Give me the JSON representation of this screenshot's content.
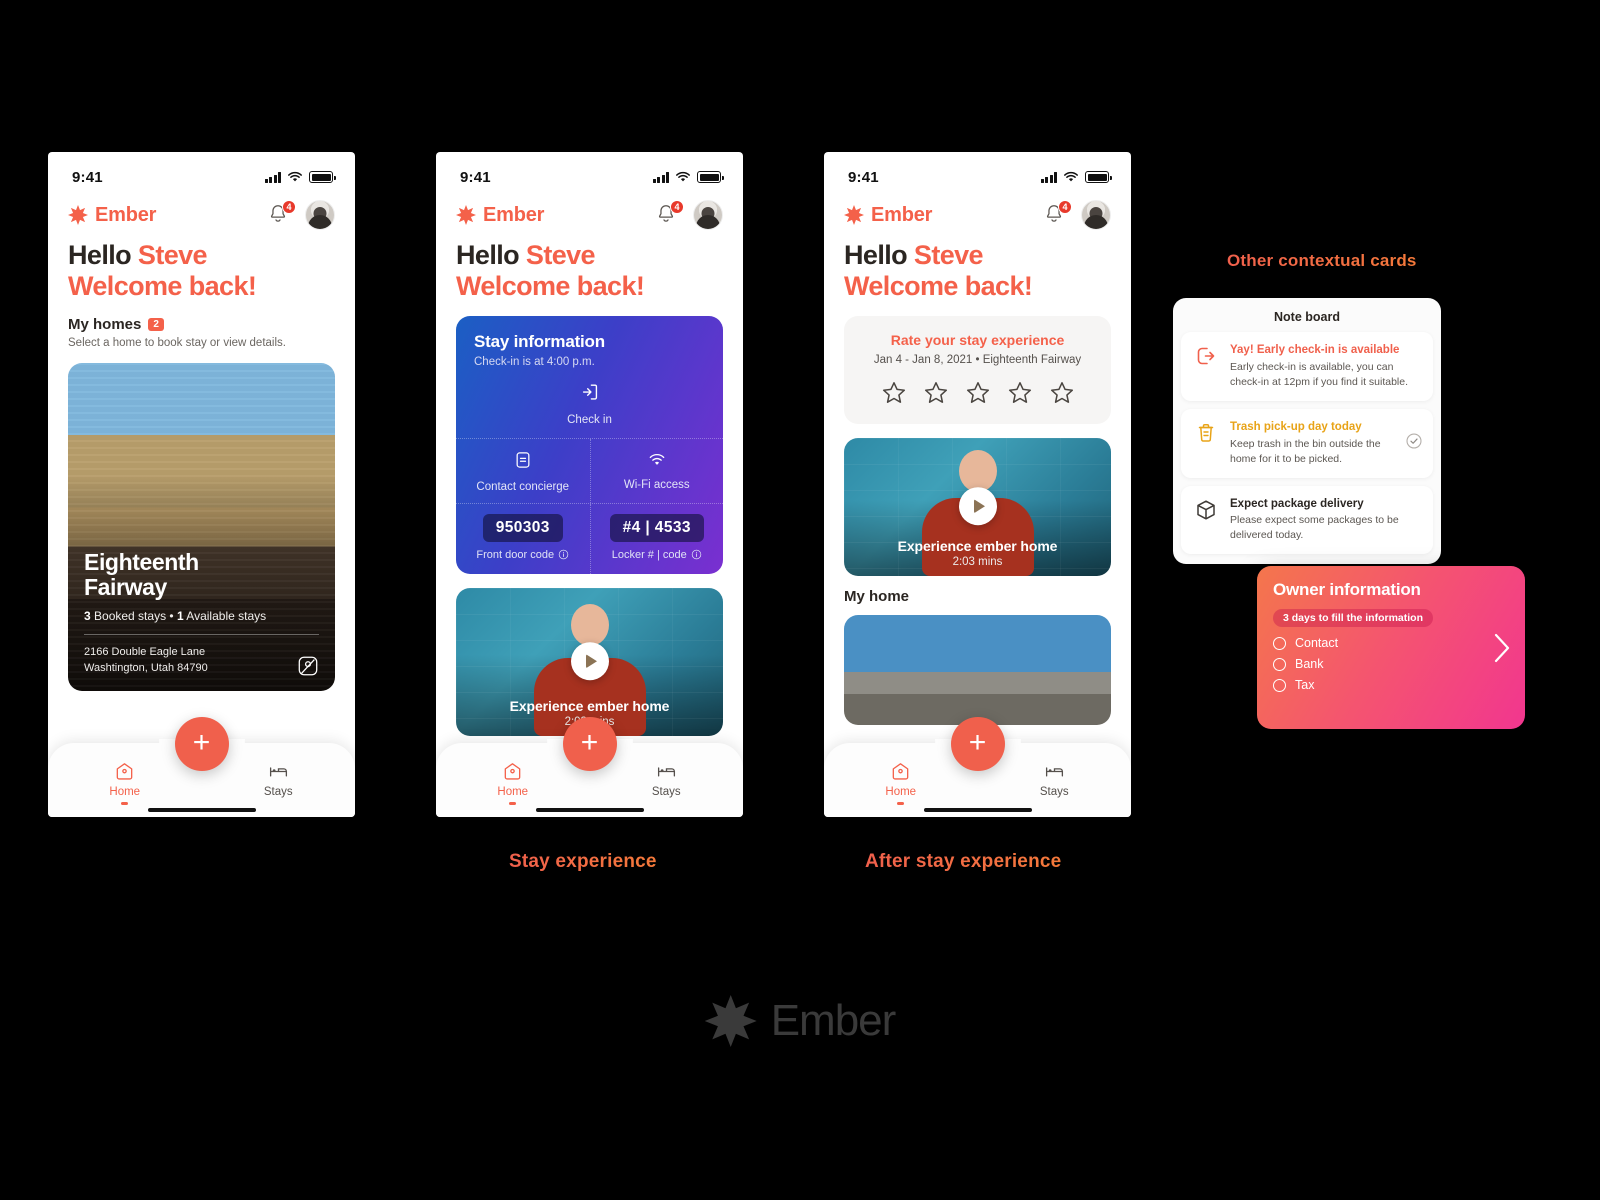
{
  "status_bar": {
    "time": "9:41"
  },
  "app": {
    "brand": "Ember",
    "notification_count": "4"
  },
  "greeting": {
    "hello": "Hello ",
    "name": "Steve",
    "line2": "Welcome back!"
  },
  "phone1": {
    "section_title": "My homes",
    "section_count": "2",
    "section_sub": "Select a home to book stay or view details.",
    "property": {
      "name_line1": "Eighteenth",
      "name_line2": "Fairway",
      "booked_count": "3",
      "booked_label": " Booked stays",
      "separator": " • ",
      "available_count": "1",
      "available_label": " Available stays",
      "address_line1": "2166 Double Eagle Lane",
      "address_line2": "Washtington, Utah 84790"
    }
  },
  "phone2": {
    "stay": {
      "title": "Stay information",
      "subtitle": "Check-in is at 4:00 p.m.",
      "checkin_label": "Check in",
      "concierge_label": "Contact concierge",
      "wifi_label": "Wi-Fi access",
      "front_door_code": "950303",
      "front_door_label": "Front door code",
      "locker_code": "#4 | 4533",
      "locker_label": "Locker # | code"
    },
    "video": {
      "title": "Experience ember home",
      "duration": "2:03 mins"
    }
  },
  "phone3": {
    "rate": {
      "title": "Rate your stay experience",
      "subtitle": "Jan 4 - Jan 8, 2021 • Eighteenth Fairway",
      "stars_total": 5,
      "stars_filled": 0
    },
    "video": {
      "title": "Experience ember home",
      "duration": "2:03 mins"
    },
    "my_home_title": "My home"
  },
  "bottom_nav": {
    "items": [
      {
        "label": "Home",
        "icon": "home-icon",
        "active": true
      },
      {
        "label": "Stays",
        "icon": "bed-icon",
        "active": false
      }
    ],
    "fab_label": "+"
  },
  "captions": {
    "stay_experience": "Stay experience",
    "after_stay_experience": "After stay experience",
    "other_contextual_cards": "Other contextual cards"
  },
  "noteboard": {
    "title": "Note board",
    "items": [
      {
        "icon": "exit-arrow-icon",
        "heading": "Yay! Early check-in is available",
        "body": "Early check-in is available, you can check-in at 12pm if you find it suitable.",
        "tone": "red",
        "checked": false
      },
      {
        "icon": "trash-icon",
        "heading": "Trash pick-up day today",
        "body": "Keep trash in the bin outside the home for it to be picked.",
        "tone": "amber",
        "checked": true
      },
      {
        "icon": "package-icon",
        "heading": "Expect package delivery",
        "body": "Please expect some packages to be delivered today.",
        "tone": "dark",
        "checked": false
      }
    ]
  },
  "owner_card": {
    "title": "Owner information",
    "pill": "3 days to fill the information",
    "rows": [
      "Contact",
      "Bank",
      "Tax"
    ]
  },
  "footer": {
    "brand": "Ember"
  },
  "colors": {
    "accent": "#F4614A",
    "fab": "#F0604C",
    "badge": "#E8392B",
    "amber": "#E8A317",
    "background": "#000000"
  }
}
